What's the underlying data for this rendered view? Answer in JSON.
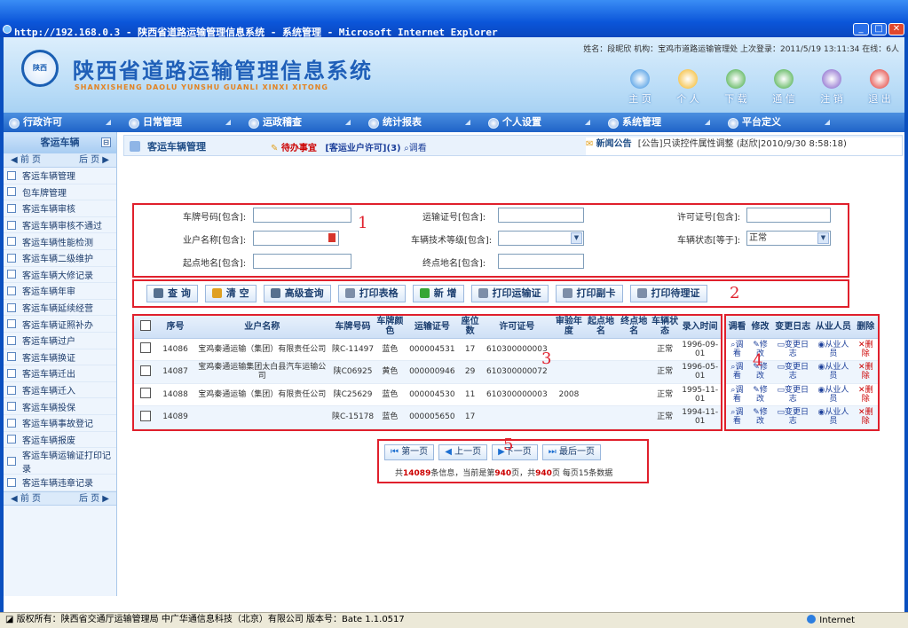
{
  "window": {
    "title": "http://192.168.0.3 - 陕西省道路运输管理信息系统 - 系统管理 - Microsoft Internet Explorer"
  },
  "header": {
    "seal_text": "陕西",
    "system_name": "陕西省道路运输管理信息系统",
    "pinyin": "SHANXISHENG DAOLU YUNSHU GUANLI XINXI XITONG",
    "user_info": "姓名：段昵欣 机构：宝鸡市道路运输管理处 上次登录：2011/5/19 13:11:34 在线：6人",
    "nav": [
      {
        "label": "主 页",
        "icon": "home-icon",
        "color": "#2f8be0"
      },
      {
        "label": "个 人",
        "icon": "user-icon",
        "color": "#f3b21a"
      },
      {
        "label": "下 载",
        "icon": "download-icon",
        "color": "#3aa63a"
      },
      {
        "label": "通 信",
        "icon": "communication-icon",
        "color": "#3aa63a"
      },
      {
        "label": "注 销",
        "icon": "logout-icon",
        "color": "#7b57c7"
      },
      {
        "label": "退 出",
        "icon": "power-icon",
        "color": "#e0302a"
      }
    ]
  },
  "menu": [
    "行政许可",
    "日常管理",
    "运政稽查",
    "统计报表",
    "个人设置",
    "系统管理",
    "平台定义"
  ],
  "sidebar": {
    "title": "客运车辆",
    "prev": "◀ 前 页",
    "next": "后 页 ▶",
    "items": [
      "客运车辆管理",
      "包车牌管理",
      "客运车辆审核",
      "客运车辆审核不通过",
      "客运车辆性能检测",
      "客运车辆二级维护",
      "客运车辆大修记录",
      "客运车辆年审",
      "客运车辆延续经营",
      "客运车辆证照补办",
      "客运车辆过户",
      "客运车辆换证",
      "客运车辆迁出",
      "客运车辆迁入",
      "客运车辆投保",
      "客运车辆事故登记",
      "客运车辆报废",
      "客运车辆运输证打印记录",
      "客运车辆违章记录"
    ]
  },
  "tabs": {
    "current": "客运车辆管理",
    "todo_label": "待办事宜",
    "todo_text": "[客运业户许可](3)",
    "todo_link": "调看",
    "news_label": "新闻公告",
    "news_text": "[公告]只读控件属性调整 (赵欣|2010/9/30 8:58:18)"
  },
  "search": {
    "plate_label": "车牌号码[包含]:",
    "transport_cert_label": "运输证号[包含]:",
    "permit_label": "许可证号[包含]:",
    "owner_label": "业户名称[包含]:",
    "tech_level_label": "车辆技术等级[包含]:",
    "status_label": "车辆状态[等于]:",
    "status_value": "正常",
    "origin_label": "起点地名[包含]:",
    "dest_label": "终点地名[包含]:"
  },
  "toolbar": [
    "查 询",
    "清 空",
    "高级查询",
    "打印表格",
    "新 增",
    "打印运输证",
    "打印副卡",
    "打印待理证"
  ],
  "annotations": [
    "1",
    "2",
    "3",
    "4",
    "5"
  ],
  "grid": {
    "headers": [
      "序号",
      "业户名称",
      "车牌号码",
      "车牌颜色",
      "运输证号",
      "座位数",
      "许可证号",
      "审验年度",
      "起点地名",
      "终点地名",
      "车辆状态",
      "录入时间"
    ],
    "rows": [
      [
        "14086",
        "宝鸡秦通运输（集团）有限责任公司",
        "陕C-11497",
        "蓝色",
        "000004531",
        "17",
        "610300000003",
        "",
        "",
        "",
        "正常",
        "1996-09-01"
      ],
      [
        "14087",
        "宝鸡秦通运输集团太白县汽车运输公司",
        "陕C06925",
        "黄色",
        "000000946",
        "29",
        "610300000072",
        "",
        "",
        "",
        "正常",
        "1996-05-01"
      ],
      [
        "14088",
        "宝鸡秦通运输（集团）有限责任公司",
        "陕C25629",
        "蓝色",
        "000004530",
        "11",
        "610300000003",
        "2008",
        "",
        "",
        "正常",
        "1995-11-01"
      ],
      [
        "14089",
        "",
        "陕C-15178",
        "蓝色",
        "000005650",
        "17",
        "",
        "",
        "",
        "",
        "正常",
        "1994-11-01"
      ]
    ]
  },
  "ops": {
    "headers": [
      "调看",
      "修改",
      "变更日志",
      "从业人员",
      "删除"
    ],
    "labels": [
      "调看",
      "修改",
      "变更日志",
      "从业人员",
      "删除"
    ]
  },
  "pager": {
    "first": "第一页",
    "prev": "上一页",
    "next": "下一页",
    "last": "最后一页",
    "info_prefix": "共",
    "total": "14089",
    "info_mid": "条信息，当前是第",
    "current_page": "940",
    "info_mid2": "页，共",
    "total_pages": "940",
    "info_suffix": "页  每页15条数据"
  },
  "status": {
    "copyright": "版权所有：陕西省交通厅运输管理局  中广华通信息科技（北京）有限公司    版本号：Bate 1.1.0517",
    "zone": "Internet"
  }
}
